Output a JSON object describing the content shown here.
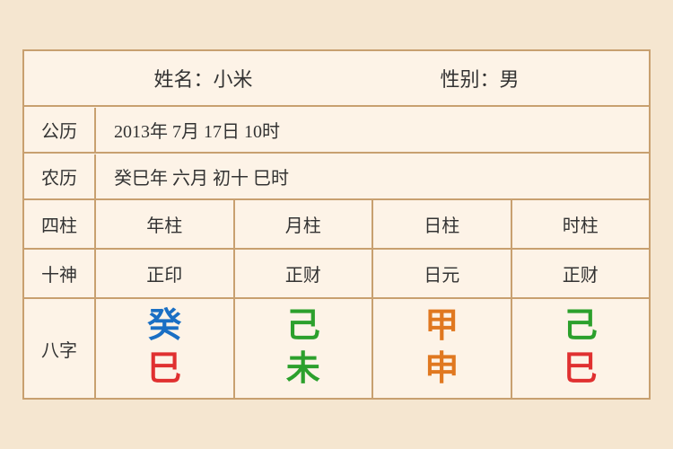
{
  "header": {
    "name_label": "姓名：小米",
    "gender_label": "性别：男"
  },
  "calendar": {
    "solar_label": "公历",
    "solar_value": "2013年 7月 17日 10时",
    "lunar_label": "农历",
    "lunar_value": "癸巳年 六月 初十 巳时"
  },
  "table": {
    "row_sizhu": {
      "label": "四柱",
      "cols": [
        "年柱",
        "月柱",
        "日柱",
        "时柱"
      ]
    },
    "row_shishen": {
      "label": "十神",
      "cols": [
        "正印",
        "正财",
        "日元",
        "正财"
      ]
    }
  },
  "bazi": {
    "label": "八字",
    "columns": [
      {
        "top_char": "癸",
        "top_color": "blue",
        "bottom_char": "巳",
        "bottom_color": "red"
      },
      {
        "top_char": "己",
        "top_color": "green",
        "bottom_char": "未",
        "bottom_color": "green"
      },
      {
        "top_char": "甲",
        "top_color": "orange",
        "bottom_char": "申",
        "bottom_color": "orange"
      },
      {
        "top_char": "己",
        "top_color": "green",
        "bottom_char": "巳",
        "bottom_color": "red"
      }
    ]
  }
}
